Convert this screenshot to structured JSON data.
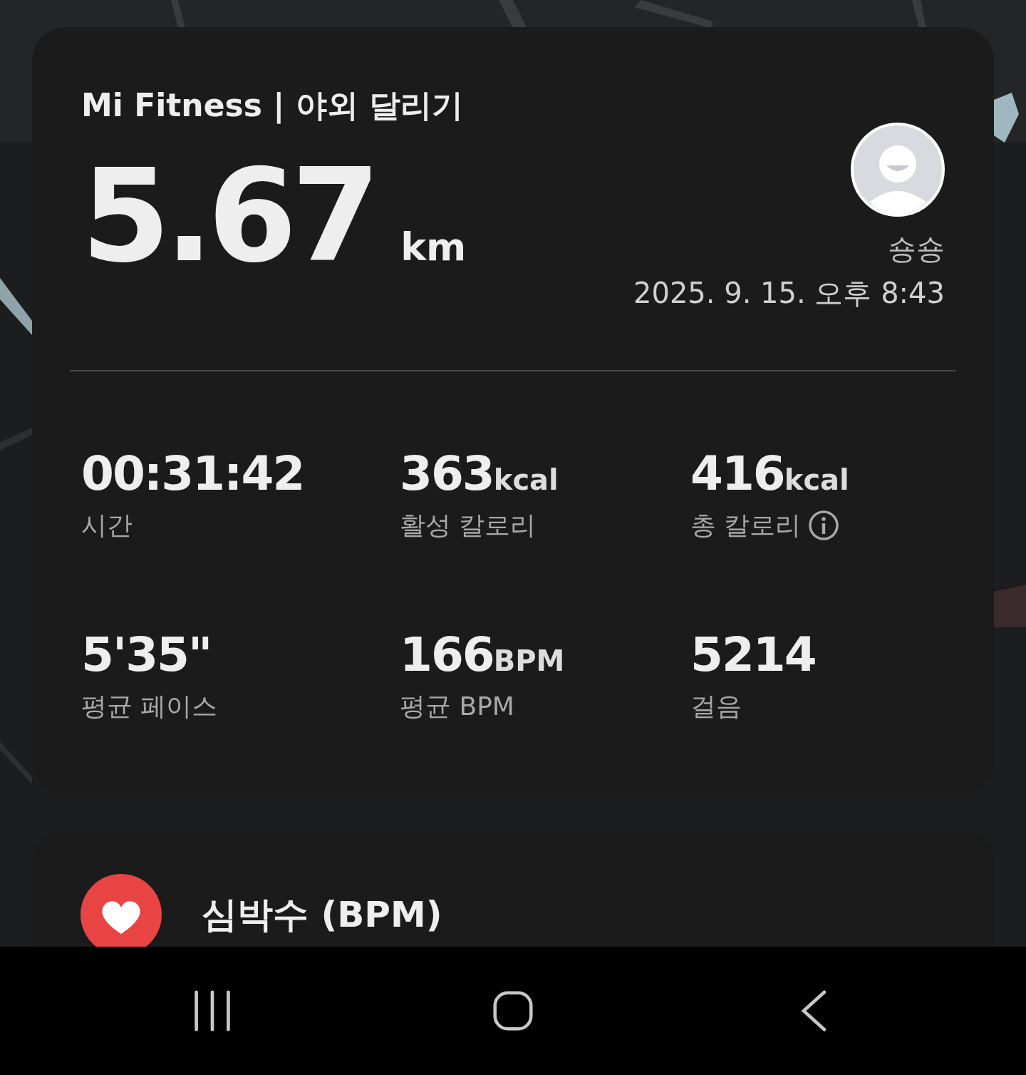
{
  "summary": {
    "title": "Mi Fitness | 야외 달리기",
    "distance": "5.67",
    "distance_unit": "km",
    "user_name": "숑숑",
    "datetime": "2025. 9. 15. 오후 8:43"
  },
  "stats": [
    {
      "value": "00:31:42",
      "label": "시간"
    },
    {
      "value": "363",
      "unit": "kcal",
      "label": "활성 칼로리"
    },
    {
      "value": "416",
      "unit": "kcal",
      "label": "총 칼로리",
      "info": true
    },
    {
      "value": "5'35\"",
      "label": "평균 페이스"
    },
    {
      "value": "166",
      "unit": "BPM",
      "label": "평균 BPM"
    },
    {
      "value": "5214",
      "label": "걸음"
    }
  ],
  "heart_section": {
    "title": "심박수 (BPM)"
  }
}
